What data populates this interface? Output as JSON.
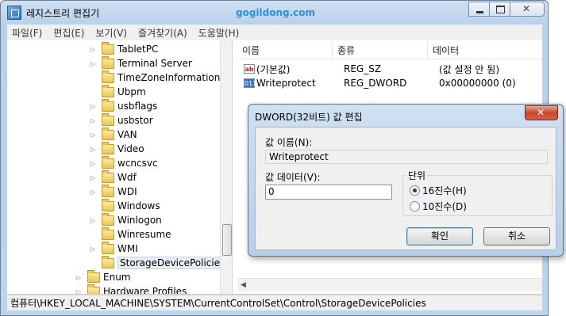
{
  "window": {
    "title": "레지스트리 편집기",
    "watermark": "gogildong.com"
  },
  "menu": [
    "파일(F)",
    "편집(E)",
    "보기(V)",
    "즐겨찾기(A)",
    "도움말(H)"
  ],
  "tree": {
    "items": [
      {
        "label": "TabletPC"
      },
      {
        "label": "Terminal Server"
      },
      {
        "label": "TimeZoneInformation"
      },
      {
        "label": "Ubpm"
      },
      {
        "label": "usbflags"
      },
      {
        "label": "usbstor"
      },
      {
        "label": "VAN"
      },
      {
        "label": "Video"
      },
      {
        "label": "wcncsvc"
      },
      {
        "label": "Wdf"
      },
      {
        "label": "WDI"
      },
      {
        "label": "Windows"
      },
      {
        "label": "Winlogon"
      },
      {
        "label": "Winresume"
      },
      {
        "label": "WMI"
      },
      {
        "label": "StorageDevicePolicies"
      },
      {
        "label": "Enum"
      },
      {
        "label": "Hardware Profiles"
      }
    ],
    "selected": "StorageDevicePolicies"
  },
  "list": {
    "headers": [
      "이름",
      "종류",
      "데이터"
    ],
    "rows": [
      {
        "icon": "string-value-icon",
        "icon_text": "ab",
        "name": "(기본값)",
        "type": "REG_SZ",
        "data": "(값 설정 안 됨)"
      },
      {
        "icon": "binary-value-icon",
        "icon_text": "011",
        "name": "Writeprotect",
        "type": "REG_DWORD",
        "data": "0x00000000 (0)"
      }
    ]
  },
  "status_path": "컴퓨터\\HKEY_LOCAL_MACHINE\\SYSTEM\\CurrentControlSet\\Control\\StorageDevicePolicies",
  "dialog": {
    "title": "DWORD(32비트) 값 편집",
    "value_name_label": "값 이름(N):",
    "value_name": "Writeprotect",
    "value_data_label": "값 데이터(V):",
    "value_data": "0",
    "base_label": "단위",
    "hex_label": "16진수(H)",
    "dec_label": "10진수(D)",
    "ok_label": "확인",
    "cancel_label": "취소",
    "selected_base": "hex"
  }
}
